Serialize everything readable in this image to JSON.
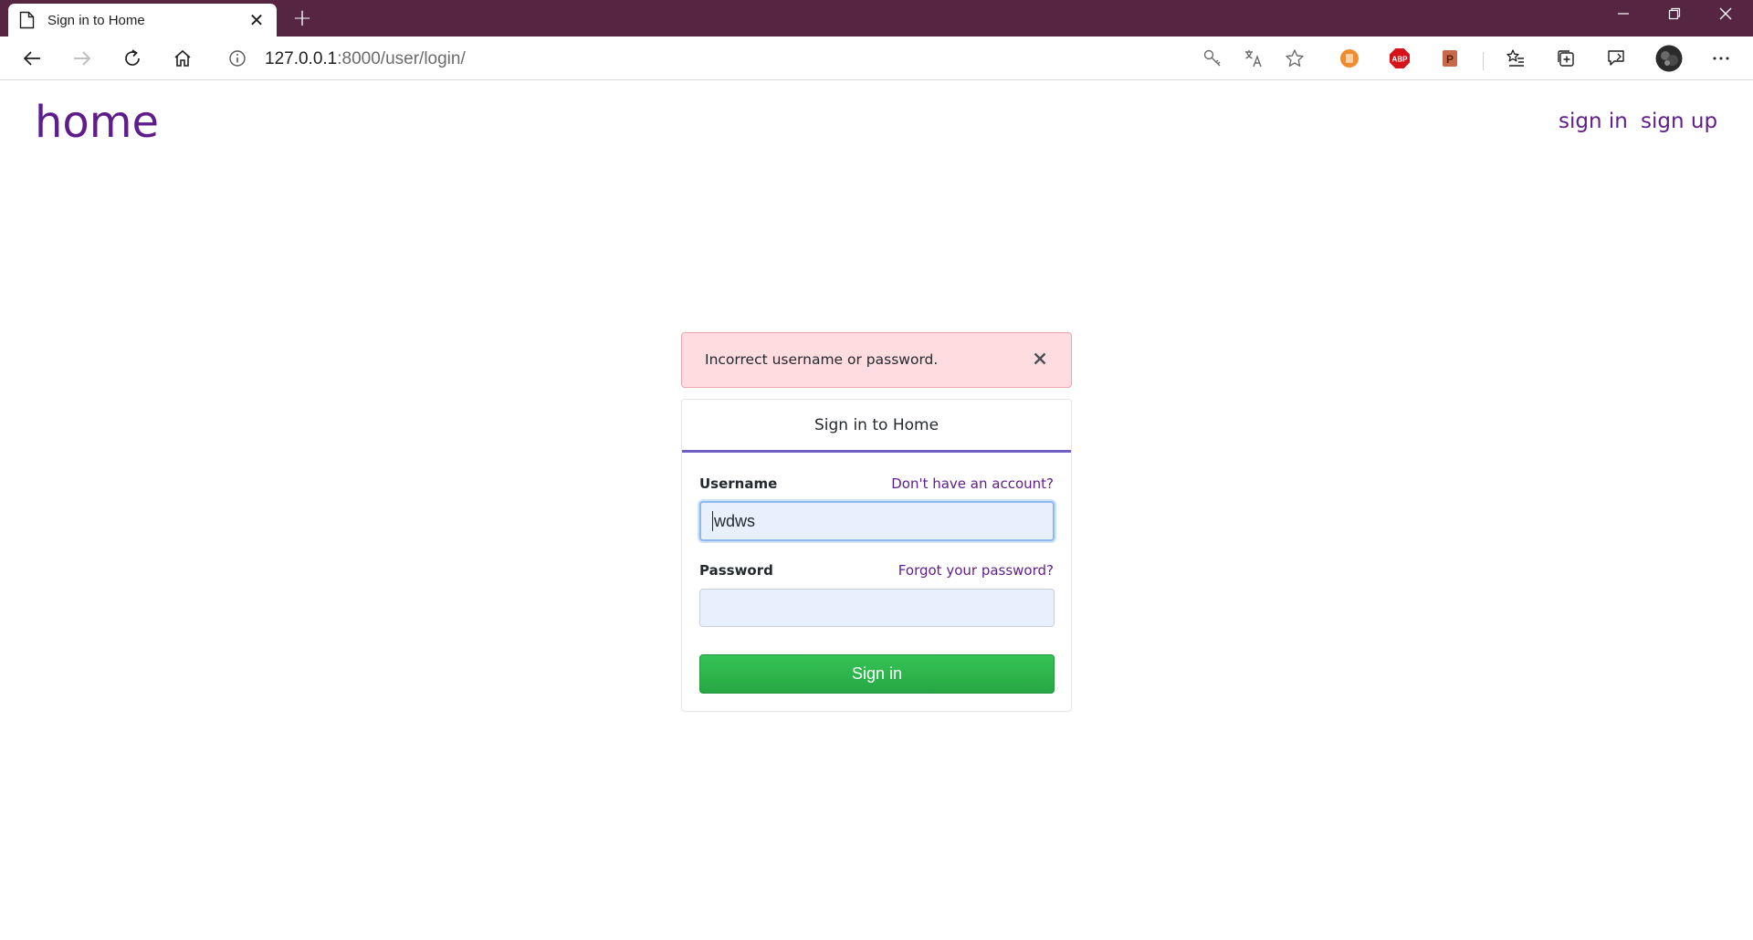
{
  "browser": {
    "tab_title": "Sign in to Home",
    "tab_close_glyph": "✕",
    "new_tab_glyph": "+",
    "address": {
      "host": "127.0.0.1",
      "rest": ":8000/user/login/"
    },
    "theme_color": "#552541"
  },
  "site": {
    "logo": "home",
    "nav": {
      "sign_in": "sign in",
      "sign_up": "sign up"
    },
    "brand_color": "#5f1d8c"
  },
  "alert": {
    "message": "Incorrect username or password.",
    "close_icon": "close-icon"
  },
  "login": {
    "title": "Sign in to Home",
    "username_label": "Username",
    "signup_link": "Don't have an account?",
    "username_value": "wdws",
    "password_label": "Password",
    "forgot_link": "Forgot your password?",
    "password_value": "",
    "submit_label": "Sign in",
    "submit_color": "#28a745"
  }
}
